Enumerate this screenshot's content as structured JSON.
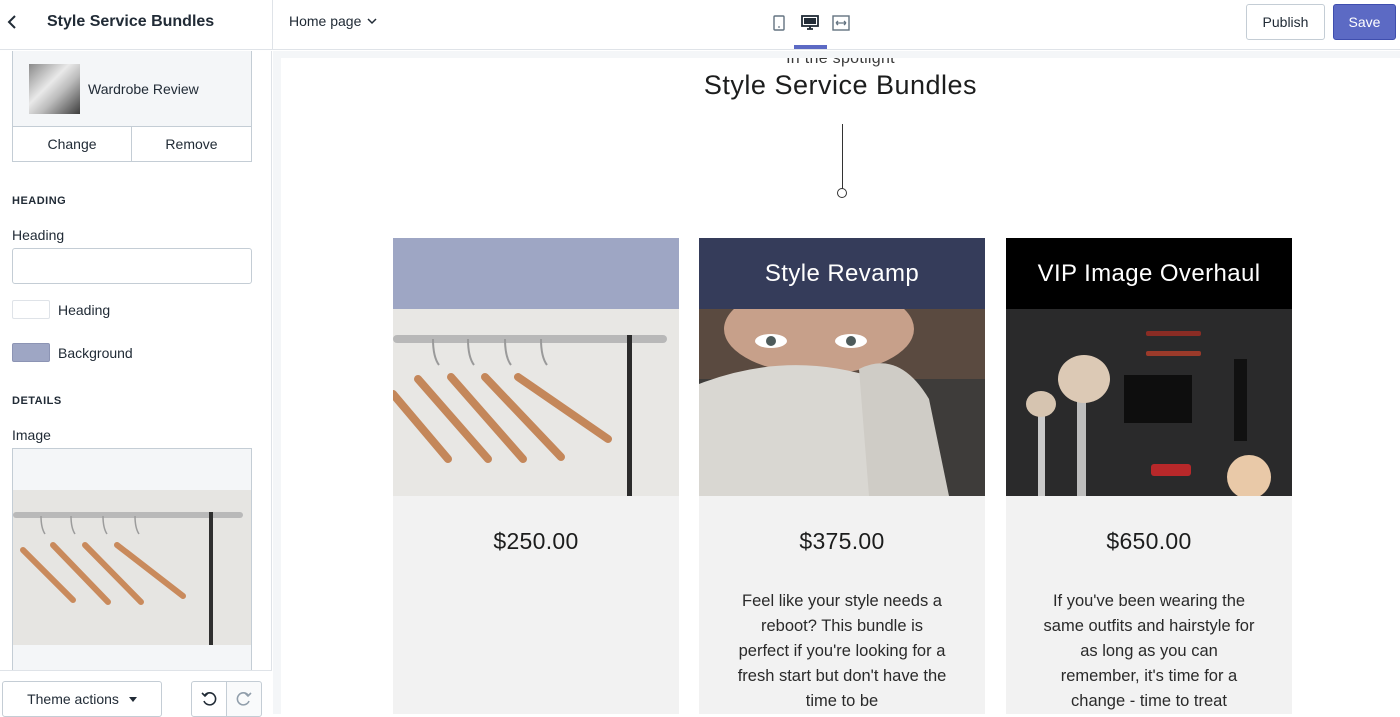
{
  "header": {
    "panel_title": "Style Service Bundles",
    "page_selector": "Home page",
    "publish_label": "Publish",
    "save_label": "Save"
  },
  "sidebar": {
    "product": {
      "name": "Wardrobe Review",
      "change_label": "Change",
      "remove_label": "Remove"
    },
    "heading_section": {
      "section_title": "HEADING",
      "field_label": "Heading",
      "field_value": "",
      "text_color_label": "Heading",
      "text_color": "#ffffff",
      "background_label": "Background",
      "background_color": "#9ea6c4"
    },
    "details_section": {
      "section_title": "DETAILS",
      "image_label": "Image"
    }
  },
  "footer": {
    "theme_actions_label": "Theme actions"
  },
  "preview": {
    "subheading": "In the spotlight",
    "heading": "Style Service Bundles",
    "cards": [
      {
        "title": "",
        "header_color": "#9ea6c4",
        "price": "$250.00",
        "description": ""
      },
      {
        "title": "Style Revamp",
        "header_color": "#353c5a",
        "price": "$375.00",
        "description": "Feel like your style needs a reboot? This bundle is perfect if you're looking for a fresh start but don't have the time to be"
      },
      {
        "title": "VIP Image Overhaul",
        "header_color": "#000000",
        "price": "$650.00",
        "description": "If you've been wearing the same outfits and hairstyle for as long as you can remember, it's time for a change - time to treat"
      }
    ]
  },
  "colors": {
    "accent": "#5c6ac4",
    "border": "#c4cdd5"
  }
}
